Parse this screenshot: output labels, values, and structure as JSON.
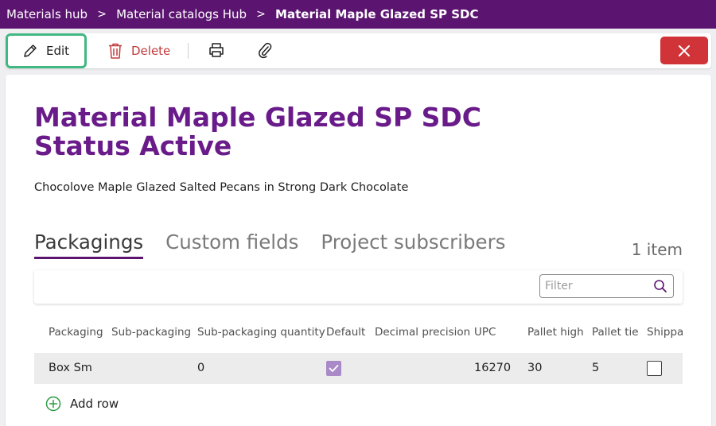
{
  "breadcrumb": {
    "items": [
      "Materials hub",
      "Material catalogs Hub",
      "Material Maple Glazed SP SDC"
    ],
    "separator": ">"
  },
  "toolbar": {
    "edit_label": "Edit",
    "delete_label": "Delete"
  },
  "icons": {
    "edit": "pencil-icon",
    "delete": "trash-icon",
    "print": "printer-icon",
    "attach": "paperclip-icon",
    "close": "close-icon",
    "search": "search-icon",
    "add": "plus-circle-icon",
    "check": "checkmark-icon"
  },
  "page": {
    "title": "Material Maple Glazed SP SDC Status Active",
    "description": "Chocolove Maple Glazed Salted Pecans in Strong Dark Chocolate"
  },
  "tabs": [
    "Packagings",
    "Custom fields",
    "Project subscribers"
  ],
  "active_tab": "Packagings",
  "item_count": "1 item",
  "filter": {
    "placeholder": "Filter",
    "value": ""
  },
  "table": {
    "columns": [
      "Packaging",
      "Sub-packaging",
      "Sub-packaging quantity",
      "Default",
      "Decimal precision",
      "UPC",
      "Pallet high",
      "Pallet tie",
      "Shippable"
    ],
    "rows": [
      {
        "packaging": "Box Sm",
        "sub_packaging": "",
        "sub_packaging_quantity": "0",
        "default": true,
        "decimal_precision": "",
        "upc": "16270",
        "pallet_high": "30",
        "pallet_tie": "5",
        "shippable": false
      }
    ]
  },
  "add_row_label": "Add row",
  "colors": {
    "header_bg": "#5c1471",
    "title": "#6a1b8a",
    "edit_highlight": "#41b883",
    "delete": "#c23b3b",
    "close_bg": "#d13438",
    "add_icon": "#2e9b45",
    "checkbox_checked": "#a989c8"
  }
}
